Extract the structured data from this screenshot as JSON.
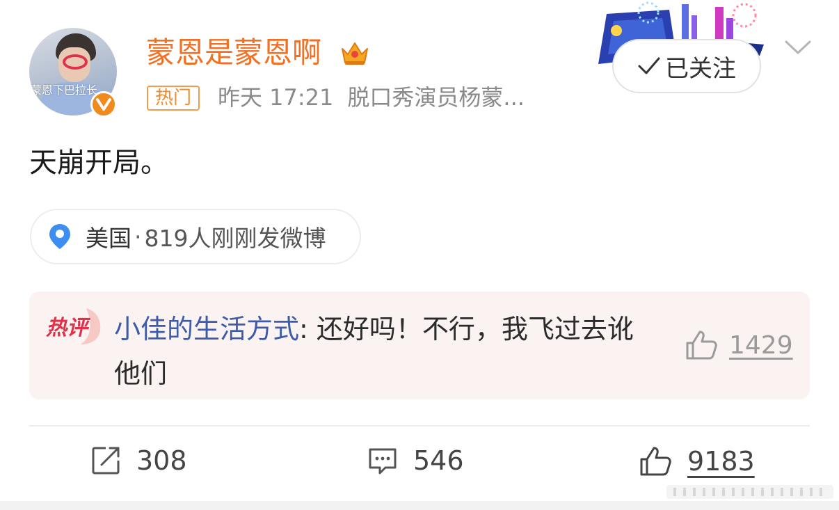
{
  "author": {
    "name": "蒙恩是蒙恩啊",
    "avatar_overlay_text": "蒙恩下巴拉长"
  },
  "meta": {
    "tag": "热门",
    "time": "昨天 17:21",
    "source": "脱口秀演员杨蒙..."
  },
  "follow_button": {
    "label": "已关注"
  },
  "post": {
    "text": "天崩开局。"
  },
  "location": {
    "place": "美国",
    "separator": "·",
    "activity": "819人刚刚发微博"
  },
  "hot_comment": {
    "label": "热评",
    "user": "小佳的生活方式",
    "text": ": 还好吗！不行，我飞过去讹他们",
    "likes": "1429"
  },
  "actions": {
    "reposts": "308",
    "comments": "546",
    "likes": "9183"
  },
  "colors": {
    "username": "#f36f21",
    "verified_badge": "#f08a1c",
    "comment_user": "#3d5ba8",
    "hot_label": "#e0314a",
    "location_pin": "#3d8ef0"
  },
  "icons": {
    "verified": "verified-v-icon",
    "crown": "crown-icon",
    "check": "check-icon",
    "chevron": "chevron-down-icon",
    "pin": "location-pin-icon",
    "thumb": "thumbs-up-icon",
    "repost": "repost-icon",
    "comment": "comment-icon"
  }
}
